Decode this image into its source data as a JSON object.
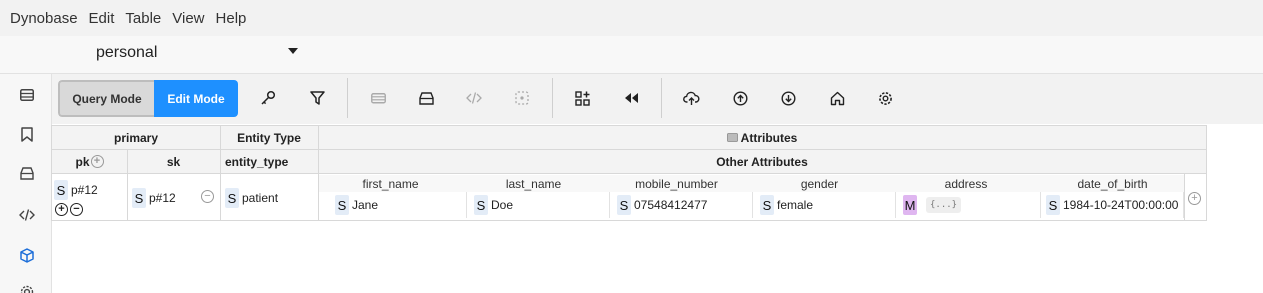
{
  "menu": {
    "items": [
      "Dynobase",
      "Edit",
      "Table",
      "View",
      "Help"
    ]
  },
  "table_selector": {
    "value": "personal"
  },
  "sidebar": {
    "icons": [
      "table-icon",
      "bookmark-icon",
      "database-icon",
      "code-icon",
      "cube-icon",
      "settings-icon"
    ]
  },
  "toolbar": {
    "query_mode_label": "Query Mode",
    "edit_mode_label": "Edit Mode",
    "active_mode": "Edit Mode",
    "accent_color": "#1e90ff"
  },
  "grid": {
    "groups": {
      "primary": "primary",
      "entity_type": "Entity Type",
      "attributes": "Attributes",
      "other_attributes": "Other Attributes"
    },
    "keys": {
      "pk": "pk",
      "sk": "sk",
      "entity_type": "entity_type"
    },
    "row": {
      "pk_type": "S",
      "pk": "p#12",
      "sk_type": "S",
      "sk": "p#12",
      "entity_type_type": "S",
      "entity_type": "patient"
    },
    "attributes": [
      {
        "name": "first_name",
        "type": "S",
        "value": "Jane"
      },
      {
        "name": "last_name",
        "type": "S",
        "value": "Doe"
      },
      {
        "name": "mobile_number",
        "type": "S",
        "value": "07548412477"
      },
      {
        "name": "gender",
        "type": "S",
        "value": "female"
      },
      {
        "name": "address",
        "type": "M",
        "value": "{...}"
      },
      {
        "name": "date_of_birth",
        "type": "S",
        "value": "1984-10-24T00:00:00"
      }
    ]
  }
}
